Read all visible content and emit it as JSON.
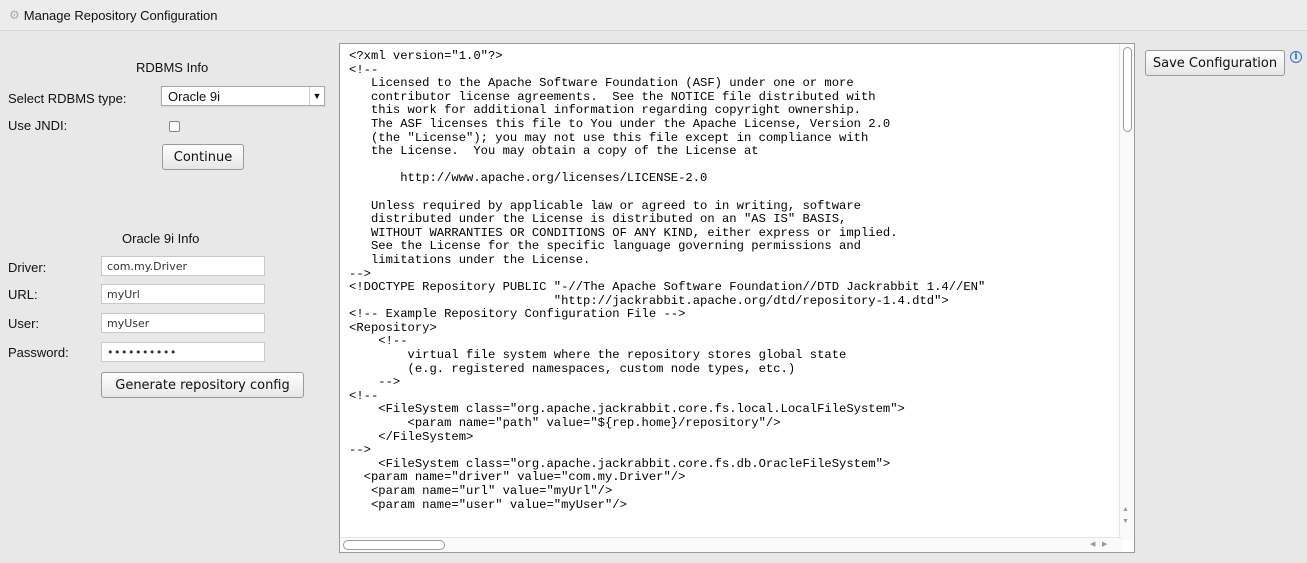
{
  "header": {
    "title": "Manage Repository Configuration",
    "icon": "gear-icon"
  },
  "rdbms": {
    "section_title": "RDBMS Info",
    "select_label": "Select RDBMS type:",
    "select_value": "Oracle 9i",
    "jndi_label": "Use JNDI:",
    "jndi_checked": false,
    "continue_label": "Continue"
  },
  "db_info": {
    "section_title": "Oracle 9i Info",
    "driver_label": "Driver:",
    "driver_value": "com.my.Driver",
    "url_label": "URL:",
    "url_value": "myUrl",
    "user_label": "User:",
    "user_value": "myUser",
    "password_label": "Password:",
    "password_value": "••••••••••",
    "generate_label": "Generate repository config"
  },
  "editor": {
    "content": "<?xml version=\"1.0\"?>\n<!--\n   Licensed to the Apache Software Foundation (ASF) under one or more\n   contributor license agreements.  See the NOTICE file distributed with\n   this work for additional information regarding copyright ownership.\n   The ASF licenses this file to You under the Apache License, Version 2.0\n   (the \"License\"); you may not use this file except in compliance with\n   the License.  You may obtain a copy of the License at\n\n       http://www.apache.org/licenses/LICENSE-2.0\n\n   Unless required by applicable law or agreed to in writing, software\n   distributed under the License is distributed on an \"AS IS\" BASIS,\n   WITHOUT WARRANTIES OR CONDITIONS OF ANY KIND, either express or implied.\n   See the License for the specific language governing permissions and\n   limitations under the License.\n-->\n<!DOCTYPE Repository PUBLIC \"-//The Apache Software Foundation//DTD Jackrabbit 1.4//EN\"\n                            \"http://jackrabbit.apache.org/dtd/repository-1.4.dtd\">\n<!-- Example Repository Configuration File -->\n<Repository>\n    <!--\n        virtual file system where the repository stores global state\n        (e.g. registered namespaces, custom node types, etc.)\n    -->\n<!--\n    <FileSystem class=\"org.apache.jackrabbit.core.fs.local.LocalFileSystem\">\n        <param name=\"path\" value=\"${rep.home}/repository\"/>\n    </FileSystem>\n-->\n    <FileSystem class=\"org.apache.jackrabbit.core.fs.db.OracleFileSystem\">\n  <param name=\"driver\" value=\"com.my.Driver\"/>\n   <param name=\"url\" value=\"myUrl\"/>\n   <param name=\"user\" value=\"myUser\"/>"
  },
  "actions": {
    "save_label": "Save Configuration",
    "info_icon": "info-icon"
  }
}
